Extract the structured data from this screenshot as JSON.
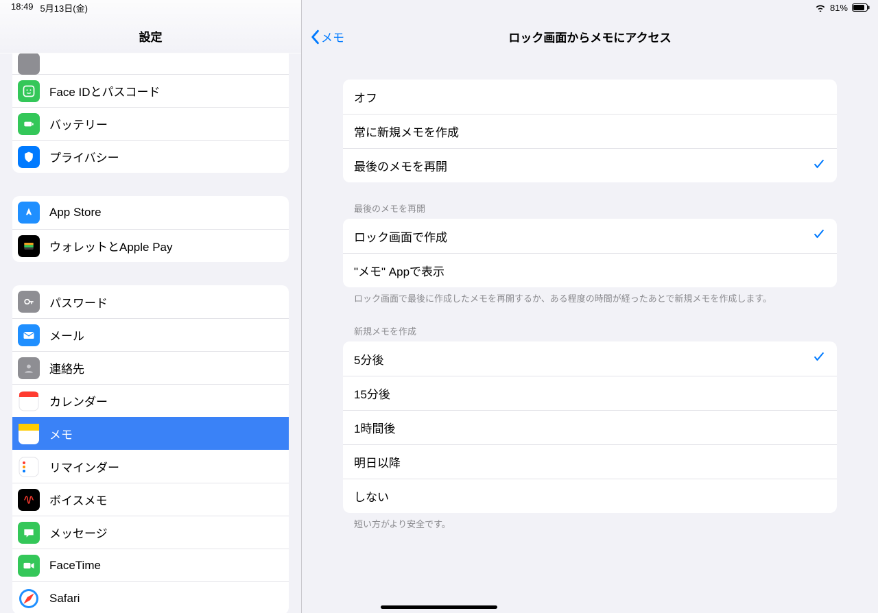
{
  "statusbar": {
    "time": "18:49",
    "date": "5月13日(金)",
    "battery_pct": "81%"
  },
  "sidebar": {
    "title": "設定",
    "groups": [
      {
        "partial": true,
        "items": [
          {
            "name": "partial",
            "label": "",
            "iconBg": "#8e8e93"
          },
          {
            "name": "faceid",
            "label": "Face IDとパスコード",
            "iconBg": "#34c759"
          },
          {
            "name": "battery",
            "label": "バッテリー",
            "iconBg": "#34c759"
          },
          {
            "name": "privacy",
            "label": "プライバシー",
            "iconBg": "#007aff"
          }
        ]
      },
      {
        "items": [
          {
            "name": "appstore",
            "label": "App Store",
            "iconBg": "#1f8fff"
          },
          {
            "name": "wallet",
            "label": "ウォレットとApple Pay",
            "iconBg": "#000"
          }
        ]
      },
      {
        "items": [
          {
            "name": "passwords",
            "label": "パスワード",
            "iconBg": "#8e8e93"
          },
          {
            "name": "mail",
            "label": "メール",
            "iconBg": "#1f8fff"
          },
          {
            "name": "contacts",
            "label": "連絡先",
            "iconBg": "#8e8e93"
          },
          {
            "name": "calendar",
            "label": "カレンダー",
            "iconBg": "#ffffff"
          },
          {
            "name": "notes",
            "label": "メモ",
            "iconBg": "#ffcc00",
            "selected": true
          },
          {
            "name": "reminders",
            "label": "リマインダー",
            "iconBg": "#ffffff"
          },
          {
            "name": "voicememos",
            "label": "ボイスメモ",
            "iconBg": "#000"
          },
          {
            "name": "messages",
            "label": "メッセージ",
            "iconBg": "#34c759"
          },
          {
            "name": "facetime",
            "label": "FaceTime",
            "iconBg": "#34c759"
          },
          {
            "name": "safari",
            "label": "Safari",
            "iconBg": "#1f8fff"
          }
        ]
      }
    ]
  },
  "main": {
    "back_label": "メモ",
    "title": "ロック画面からメモにアクセス",
    "sections": [
      {
        "options": [
          {
            "label": "オフ"
          },
          {
            "label": "常に新規メモを作成"
          },
          {
            "label": "最後のメモを再開",
            "checked": true
          }
        ]
      },
      {
        "header": "最後のメモを再開",
        "options": [
          {
            "label": "ロック画面で作成",
            "checked": true
          },
          {
            "label": "\"メモ\" Appで表示"
          }
        ],
        "footer": "ロック画面で最後に作成したメモを再開するか、ある程度の時間が経ったあとで新規メモを作成します。"
      },
      {
        "header": "新規メモを作成",
        "options": [
          {
            "label": "5分後",
            "checked": true
          },
          {
            "label": "15分後"
          },
          {
            "label": "1時間後"
          },
          {
            "label": "明日以降"
          },
          {
            "label": "しない"
          }
        ],
        "footer": "短い方がより安全です。"
      }
    ]
  }
}
